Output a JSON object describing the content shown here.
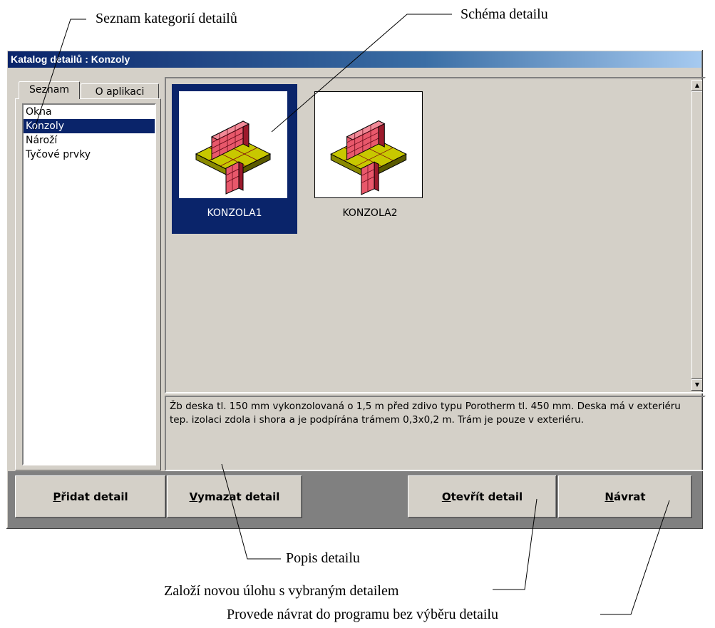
{
  "callouts": {
    "category_list": "Seznam kategorií detailů",
    "detail_schema": "Schéma detailu",
    "detail_description": "Popis detailu",
    "open_detail": "Založí novou úlohu s vybraným detailem",
    "return": "Provede návrat do programu bez výběru detailu"
  },
  "window": {
    "title": "Katalog detailů : Konzoly"
  },
  "tabs": [
    {
      "label": "Seznam",
      "active": true
    },
    {
      "label": "O aplikaci",
      "active": false
    }
  ],
  "categories": [
    {
      "label": "Okna",
      "selected": false
    },
    {
      "label": "Konzoly",
      "selected": true
    },
    {
      "label": "Nároží",
      "selected": false
    },
    {
      "label": "Tyčové prvky",
      "selected": false
    }
  ],
  "details": [
    {
      "name": "KONZOLA1",
      "selected": true
    },
    {
      "name": "KONZOLA2",
      "selected": false
    }
  ],
  "description": "Žb deska tl. 150 mm vykonzolovaná o 1,5 m před zdivo typu Porotherm tl. 450 mm. Deska má v exteriéru tep. izolaci zdola i shora a je podpírána trámem 0,3x0,2 m. Trám je pouze v exteriéru.",
  "buttons": {
    "add": {
      "accel": "P",
      "rest": "řidat detail"
    },
    "delete": {
      "accel": "V",
      "rest": "ymazat detail"
    },
    "open": {
      "accel": "O",
      "rest": "tevřít detail"
    },
    "back": {
      "accel": "N",
      "rest": "ávrat"
    }
  },
  "colors": {
    "selection": "#0a246a",
    "face": "#d4d0c8",
    "slab": "#c8c800",
    "brick": "#e8586b"
  }
}
